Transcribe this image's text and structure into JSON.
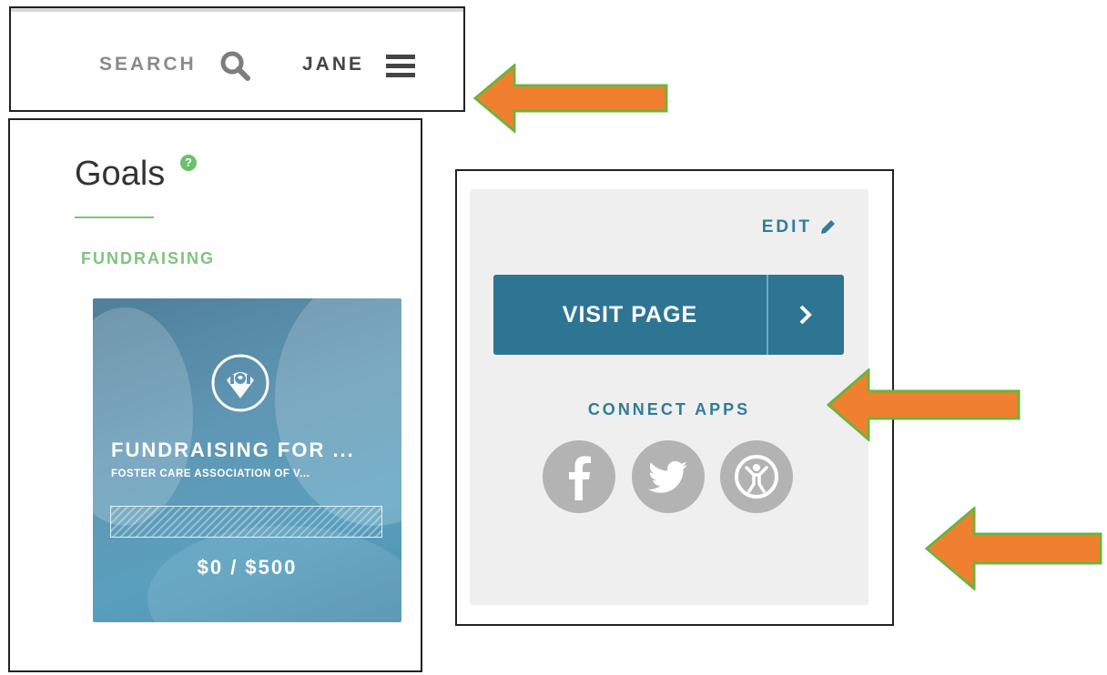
{
  "header": {
    "search_label": "SEARCH",
    "user_name": "JANE",
    "icons": [
      "search-icon",
      "menu-icon"
    ]
  },
  "goals": {
    "title": "Goals",
    "help_glyph": "?",
    "section_label": "FUNDRAISING",
    "card": {
      "icon": "fundraising-badge-icon",
      "title": "FUNDRAISING FOR ...",
      "subtitle": "FOSTER CARE ASSOCIATION OF V...",
      "progress_fraction": 0,
      "amount": "$0 / $500"
    }
  },
  "profile_actions": {
    "edit_label": "EDIT",
    "visit_label": "VISIT PAGE",
    "connect_label": "CONNECT APPS",
    "apps": [
      "facebook",
      "twitter",
      "exercise-app"
    ]
  },
  "colors": {
    "accent_blue": "#2d7593",
    "accent_green": "#7fc37c",
    "arrow_orange": "#f08030",
    "arrow_border": "#6db33f",
    "app_icon_gray": "#b3b3b3"
  }
}
